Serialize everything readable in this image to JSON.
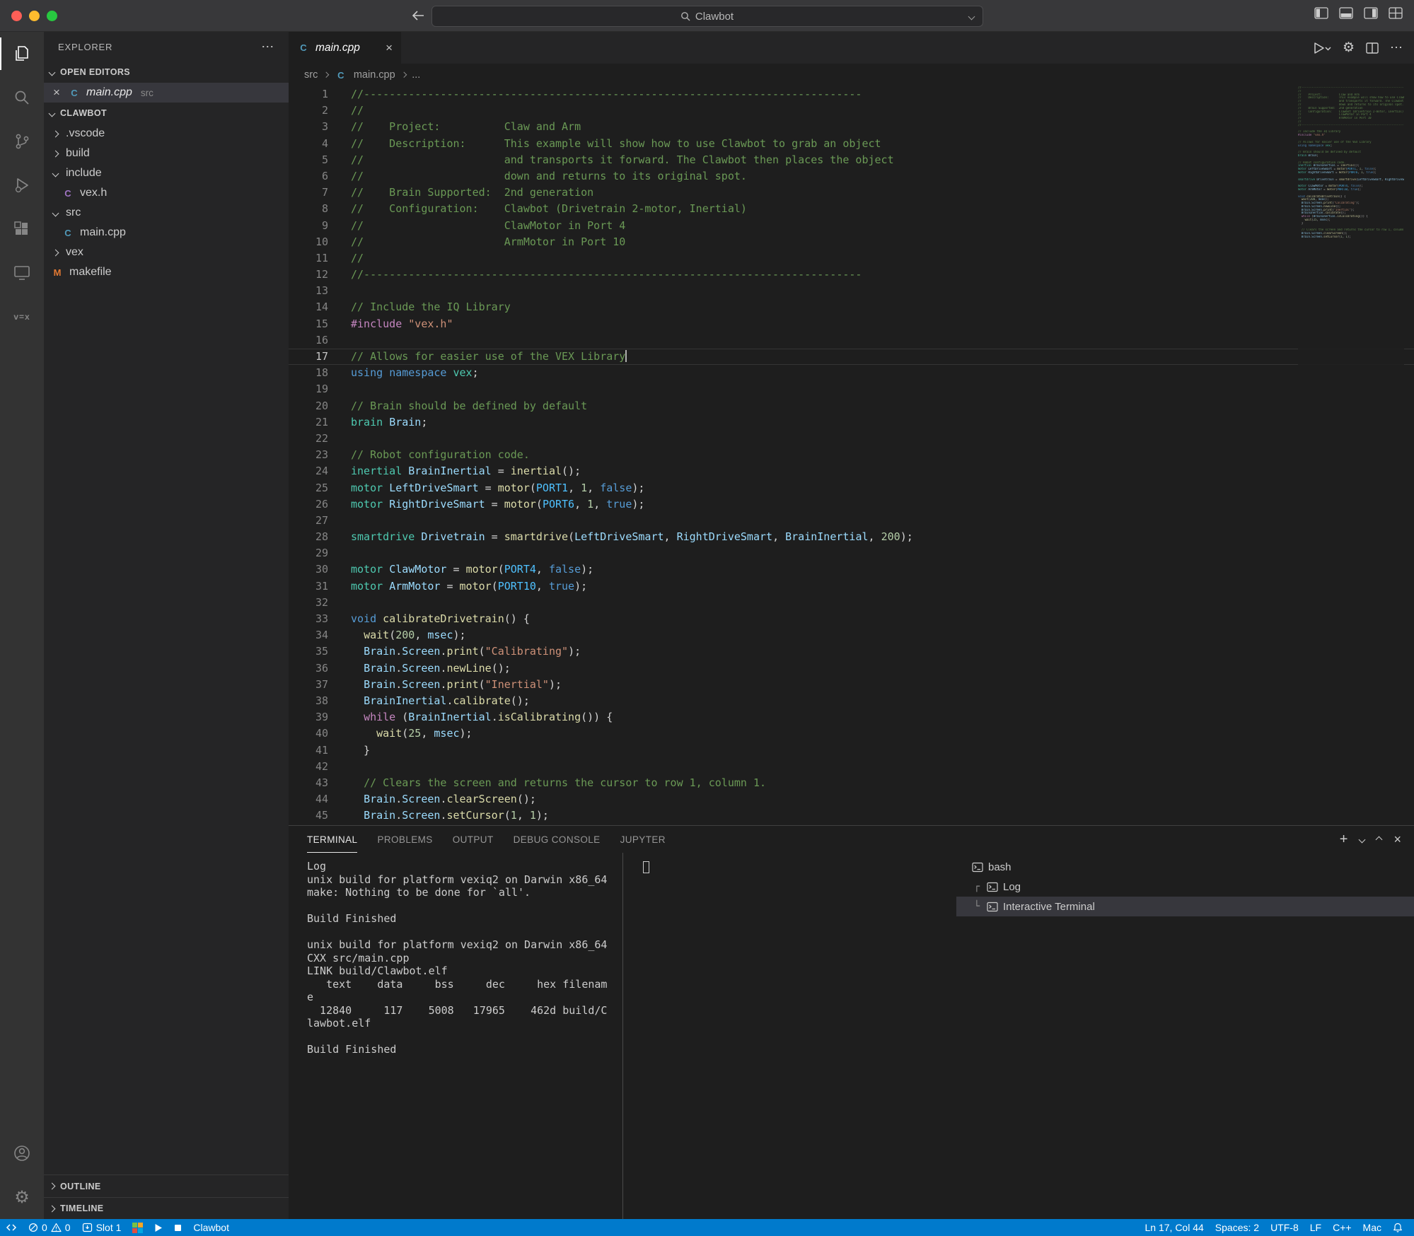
{
  "titlebar": {
    "search_label": "Clawbot"
  },
  "activity_bar": {
    "items": [
      "explorer-icon",
      "search-icon",
      "source-control-icon",
      "run-debug-icon",
      "extensions-icon",
      "remote-explorer-icon",
      "vex-icon"
    ],
    "bottom_items": [
      "account-icon",
      "settings-gear-icon"
    ]
  },
  "sidebar": {
    "title": "EXPLORER",
    "more_label": "⋯",
    "open_editors_label": "OPEN EDITORS",
    "open_editor": {
      "label": "main.cpp",
      "detail": "src",
      "close": "×"
    },
    "root_label": "CLAWBOT",
    "tree": [
      {
        "label": ".vscode",
        "kind": "folder",
        "state": "collapsed",
        "depth": 1
      },
      {
        "label": "build",
        "kind": "folder",
        "state": "collapsed",
        "depth": 1
      },
      {
        "label": "include",
        "kind": "folder",
        "state": "expanded",
        "depth": 1
      },
      {
        "label": "vex.h",
        "kind": "file",
        "icon": "h",
        "glyph": "C",
        "depth": 2
      },
      {
        "label": "src",
        "kind": "folder",
        "state": "expanded",
        "depth": 1
      },
      {
        "label": "main.cpp",
        "kind": "file",
        "icon": "cpp",
        "glyph": "C",
        "depth": 2
      },
      {
        "label": "vex",
        "kind": "folder",
        "state": "collapsed",
        "depth": 1
      },
      {
        "label": "makefile",
        "kind": "file",
        "icon": "makefile",
        "glyph": "M",
        "depth": 1
      }
    ],
    "bottom_sections": [
      "OUTLINE",
      "TIMELINE"
    ]
  },
  "editor": {
    "tab": {
      "label": "main.cpp",
      "close": "×"
    },
    "breadcrumbs": [
      "src",
      "main.cpp",
      "..."
    ],
    "cursor": {
      "line": 17,
      "col": 44
    },
    "lines": [
      [
        [
          "c",
          "//------------------------------------------------------------------------------"
        ]
      ],
      [
        [
          "c",
          "//"
        ]
      ],
      [
        [
          "c",
          "//    Project:          Claw and Arm"
        ]
      ],
      [
        [
          "c",
          "//    Description:      This example will show how to use Clawbot to grab an object"
        ]
      ],
      [
        [
          "c",
          "//                      and transports it forward. The Clawbot then places the object"
        ]
      ],
      [
        [
          "c",
          "//                      down and returns to its original spot."
        ]
      ],
      [
        [
          "c",
          "//    Brain Supported:  2nd generation"
        ]
      ],
      [
        [
          "c",
          "//    Configuration:    Clawbot (Drivetrain 2-motor, Inertial)"
        ]
      ],
      [
        [
          "c",
          "//                      ClawMotor in Port 4"
        ]
      ],
      [
        [
          "c",
          "//                      ArmMotor in Port 10"
        ]
      ],
      [
        [
          "c",
          "//"
        ]
      ],
      [
        [
          "c",
          "//------------------------------------------------------------------------------"
        ]
      ],
      [],
      [
        [
          "c",
          "// Include the IQ Library"
        ]
      ],
      [
        [
          "kc",
          "#include"
        ],
        [
          "d",
          " "
        ],
        [
          "s",
          "\"vex.h\""
        ]
      ],
      [],
      [
        [
          "c",
          "// Allows for easier use of the VEX Library"
        ]
      ],
      [
        [
          "k",
          "using"
        ],
        [
          "d",
          " "
        ],
        [
          "k",
          "namespace"
        ],
        [
          "d",
          " "
        ],
        [
          "t",
          "vex"
        ],
        [
          "d",
          ";"
        ]
      ],
      [],
      [
        [
          "c",
          "// Brain should be defined by default"
        ]
      ],
      [
        [
          "t",
          "brain"
        ],
        [
          "d",
          " "
        ],
        [
          "v",
          "Brain"
        ],
        [
          "d",
          ";"
        ]
      ],
      [],
      [
        [
          "c",
          "// Robot configuration code."
        ]
      ],
      [
        [
          "t",
          "inertial"
        ],
        [
          "d",
          " "
        ],
        [
          "v",
          "BrainInertial"
        ],
        [
          "d",
          " = "
        ],
        [
          "f",
          "inertial"
        ],
        [
          "d",
          "();"
        ]
      ],
      [
        [
          "t",
          "motor"
        ],
        [
          "d",
          " "
        ],
        [
          "v",
          "LeftDriveSmart"
        ],
        [
          "d",
          " = "
        ],
        [
          "f",
          "motor"
        ],
        [
          "d",
          "("
        ],
        [
          "e",
          "PORT1"
        ],
        [
          "d",
          ", "
        ],
        [
          "n",
          "1"
        ],
        [
          "d",
          ", "
        ],
        [
          "k",
          "false"
        ],
        [
          "d",
          ");"
        ]
      ],
      [
        [
          "t",
          "motor"
        ],
        [
          "d",
          " "
        ],
        [
          "v",
          "RightDriveSmart"
        ],
        [
          "d",
          " = "
        ],
        [
          "f",
          "motor"
        ],
        [
          "d",
          "("
        ],
        [
          "e",
          "PORT6"
        ],
        [
          "d",
          ", "
        ],
        [
          "n",
          "1"
        ],
        [
          "d",
          ", "
        ],
        [
          "k",
          "true"
        ],
        [
          "d",
          ");"
        ]
      ],
      [],
      [
        [
          "t",
          "smartdrive"
        ],
        [
          "d",
          " "
        ],
        [
          "v",
          "Drivetrain"
        ],
        [
          "d",
          " = "
        ],
        [
          "f",
          "smartdrive"
        ],
        [
          "d",
          "("
        ],
        [
          "v",
          "LeftDriveSmart"
        ],
        [
          "d",
          ", "
        ],
        [
          "v",
          "RightDriveSmart"
        ],
        [
          "d",
          ", "
        ],
        [
          "v",
          "BrainInertial"
        ],
        [
          "d",
          ", "
        ],
        [
          "n",
          "200"
        ],
        [
          "d",
          ");"
        ]
      ],
      [],
      [
        [
          "t",
          "motor"
        ],
        [
          "d",
          " "
        ],
        [
          "v",
          "ClawMotor"
        ],
        [
          "d",
          " = "
        ],
        [
          "f",
          "motor"
        ],
        [
          "d",
          "("
        ],
        [
          "e",
          "PORT4"
        ],
        [
          "d",
          ", "
        ],
        [
          "k",
          "false"
        ],
        [
          "d",
          ");"
        ]
      ],
      [
        [
          "t",
          "motor"
        ],
        [
          "d",
          " "
        ],
        [
          "v",
          "ArmMotor"
        ],
        [
          "d",
          " = "
        ],
        [
          "f",
          "motor"
        ],
        [
          "d",
          "("
        ],
        [
          "e",
          "PORT10"
        ],
        [
          "d",
          ", "
        ],
        [
          "k",
          "true"
        ],
        [
          "d",
          ");"
        ]
      ],
      [],
      [
        [
          "k",
          "void"
        ],
        [
          "d",
          " "
        ],
        [
          "f",
          "calibrateDrivetrain"
        ],
        [
          "d",
          "() {"
        ]
      ],
      [
        [
          "d",
          "  "
        ],
        [
          "f",
          "wait"
        ],
        [
          "d",
          "("
        ],
        [
          "n",
          "200"
        ],
        [
          "d",
          ", "
        ],
        [
          "v",
          "msec"
        ],
        [
          "d",
          ");"
        ]
      ],
      [
        [
          "d",
          "  "
        ],
        [
          "v",
          "Brain"
        ],
        [
          "d",
          "."
        ],
        [
          "v",
          "Screen"
        ],
        [
          "d",
          "."
        ],
        [
          "f",
          "print"
        ],
        [
          "d",
          "("
        ],
        [
          "s",
          "\"Calibrating\""
        ],
        [
          "d",
          ");"
        ]
      ],
      [
        [
          "d",
          "  "
        ],
        [
          "v",
          "Brain"
        ],
        [
          "d",
          "."
        ],
        [
          "v",
          "Screen"
        ],
        [
          "d",
          "."
        ],
        [
          "f",
          "newLine"
        ],
        [
          "d",
          "();"
        ]
      ],
      [
        [
          "d",
          "  "
        ],
        [
          "v",
          "Brain"
        ],
        [
          "d",
          "."
        ],
        [
          "v",
          "Screen"
        ],
        [
          "d",
          "."
        ],
        [
          "f",
          "print"
        ],
        [
          "d",
          "("
        ],
        [
          "s",
          "\"Inertial\""
        ],
        [
          "d",
          ");"
        ]
      ],
      [
        [
          "d",
          "  "
        ],
        [
          "v",
          "BrainInertial"
        ],
        [
          "d",
          "."
        ],
        [
          "f",
          "calibrate"
        ],
        [
          "d",
          "();"
        ]
      ],
      [
        [
          "d",
          "  "
        ],
        [
          "kc",
          "while"
        ],
        [
          "d",
          " ("
        ],
        [
          "v",
          "BrainInertial"
        ],
        [
          "d",
          "."
        ],
        [
          "f",
          "isCalibrating"
        ],
        [
          "d",
          "()) {"
        ]
      ],
      [
        [
          "d",
          "    "
        ],
        [
          "f",
          "wait"
        ],
        [
          "d",
          "("
        ],
        [
          "n",
          "25"
        ],
        [
          "d",
          ", "
        ],
        [
          "v",
          "msec"
        ],
        [
          "d",
          ");"
        ]
      ],
      [
        [
          "d",
          "  }"
        ]
      ],
      [],
      [
        [
          "d",
          "  "
        ],
        [
          "c",
          "// Clears the screen and returns the cursor to row 1, column 1."
        ]
      ],
      [
        [
          "d",
          "  "
        ],
        [
          "v",
          "Brain"
        ],
        [
          "d",
          "."
        ],
        [
          "v",
          "Screen"
        ],
        [
          "d",
          "."
        ],
        [
          "f",
          "clearScreen"
        ],
        [
          "d",
          "();"
        ]
      ],
      [
        [
          "d",
          "  "
        ],
        [
          "v",
          "Brain"
        ],
        [
          "d",
          "."
        ],
        [
          "v",
          "Screen"
        ],
        [
          "d",
          "."
        ],
        [
          "f",
          "setCursor"
        ],
        [
          "d",
          "("
        ],
        [
          "n",
          "1"
        ],
        [
          "d",
          ", "
        ],
        [
          "n",
          "1"
        ],
        [
          "d",
          ");"
        ]
      ]
    ]
  },
  "panel": {
    "tabs": [
      {
        "label": "TERMINAL",
        "active": true
      },
      {
        "label": "PROBLEMS"
      },
      {
        "label": "OUTPUT"
      },
      {
        "label": "DEBUG CONSOLE"
      },
      {
        "label": "JUPYTER"
      }
    ],
    "terminal_output": [
      "Log",
      "unix build for platform vexiq2 on Darwin x86_64",
      "make: Nothing to be done for `all'.",
      "",
      "Build Finished",
      "",
      "unix build for platform vexiq2 on Darwin x86_64",
      "CXX src/main.cpp",
      "LINK build/Clawbot.elf",
      "   text    data     bss     dec     hex filenam",
      "e",
      "  12840     117    5008   17965    462d build/C",
      "lawbot.elf",
      "",
      "Build Finished"
    ],
    "terminal_list": [
      {
        "label": "bash",
        "prefix": ""
      },
      {
        "label": "Log",
        "prefix": "┌"
      },
      {
        "label": "Interactive Terminal",
        "prefix": "└",
        "selected": true
      }
    ]
  },
  "statusbar": {
    "errors": "0",
    "warnings": "0",
    "slot": "Slot 1",
    "project": "Clawbot",
    "cursor": "Ln 17, Col 44",
    "indent": "Spaces: 2",
    "encoding": "UTF-8",
    "eol": "LF",
    "language": "C++",
    "host": "Mac"
  }
}
